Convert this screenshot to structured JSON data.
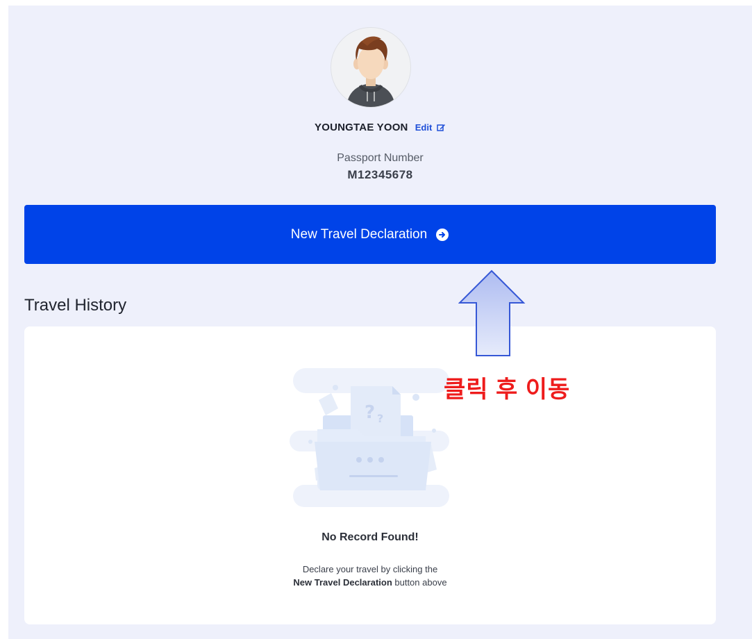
{
  "profile": {
    "name": "YOUNGTAE YOON",
    "edit_label": "Edit",
    "passport_label": "Passport Number",
    "passport_number": "M12345678"
  },
  "actions": {
    "new_declaration_label": "New Travel Declaration"
  },
  "history": {
    "title": "Travel History",
    "empty_title": "No Record Found!",
    "empty_desc_line1": "Declare your travel by clicking the",
    "empty_desc_bold": "New Travel Declaration",
    "empty_desc_suffix": " button above"
  },
  "annotation": {
    "text": "클릭 후 이동"
  },
  "colors": {
    "primary": "#0043e8",
    "page_bg": "#eef0fb",
    "annotation_red": "#ee1c1c",
    "arrow_fill": "#c9d2f6"
  }
}
